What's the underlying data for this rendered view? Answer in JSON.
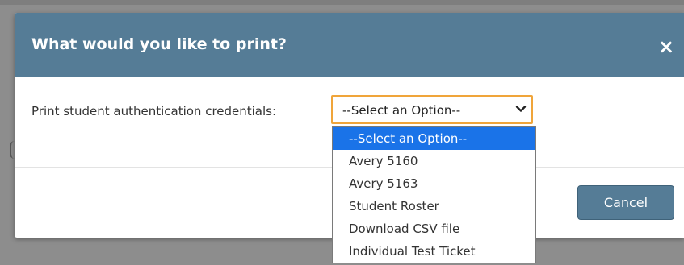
{
  "dialog": {
    "title": "What would you like to print?",
    "close_label": "×",
    "field_label": "Print student authentication credentials:",
    "select": {
      "selected_value": "--Select an Option--",
      "options": [
        "--Select an Option--",
        "Avery 5160",
        "Avery 5163",
        "Student Roster",
        "Download CSV file",
        "Individual Test Ticket"
      ]
    },
    "cancel_label": "Cancel"
  },
  "colors": {
    "header": "#557c96",
    "focus_border": "#f0a53a",
    "selected_option": "#1a73e8",
    "overlay": "#8d8d8d"
  },
  "icons": {
    "close": "close-icon",
    "dropdown": "chevron-down-icon"
  }
}
